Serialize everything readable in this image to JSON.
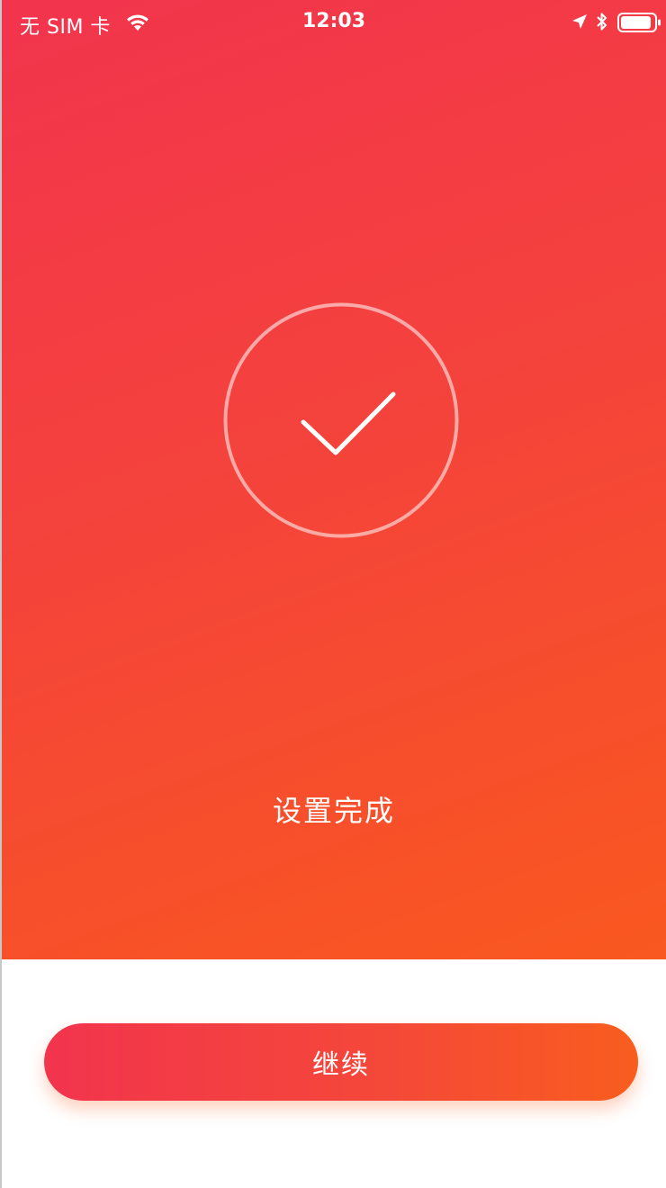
{
  "status_bar": {
    "carrier": "无 SIM 卡",
    "time": "12:03",
    "icons": [
      "wifi-icon",
      "location-icon",
      "bluetooth-icon",
      "battery-icon"
    ]
  },
  "main": {
    "status_icon": "checkmark-circle-icon",
    "title": "设置完成"
  },
  "actions": {
    "continue_label": "继续"
  },
  "colors": {
    "gradient_start": "#f2344d",
    "gradient_end": "#f9581f",
    "background": "#ffffff",
    "text": "#ffffff"
  }
}
